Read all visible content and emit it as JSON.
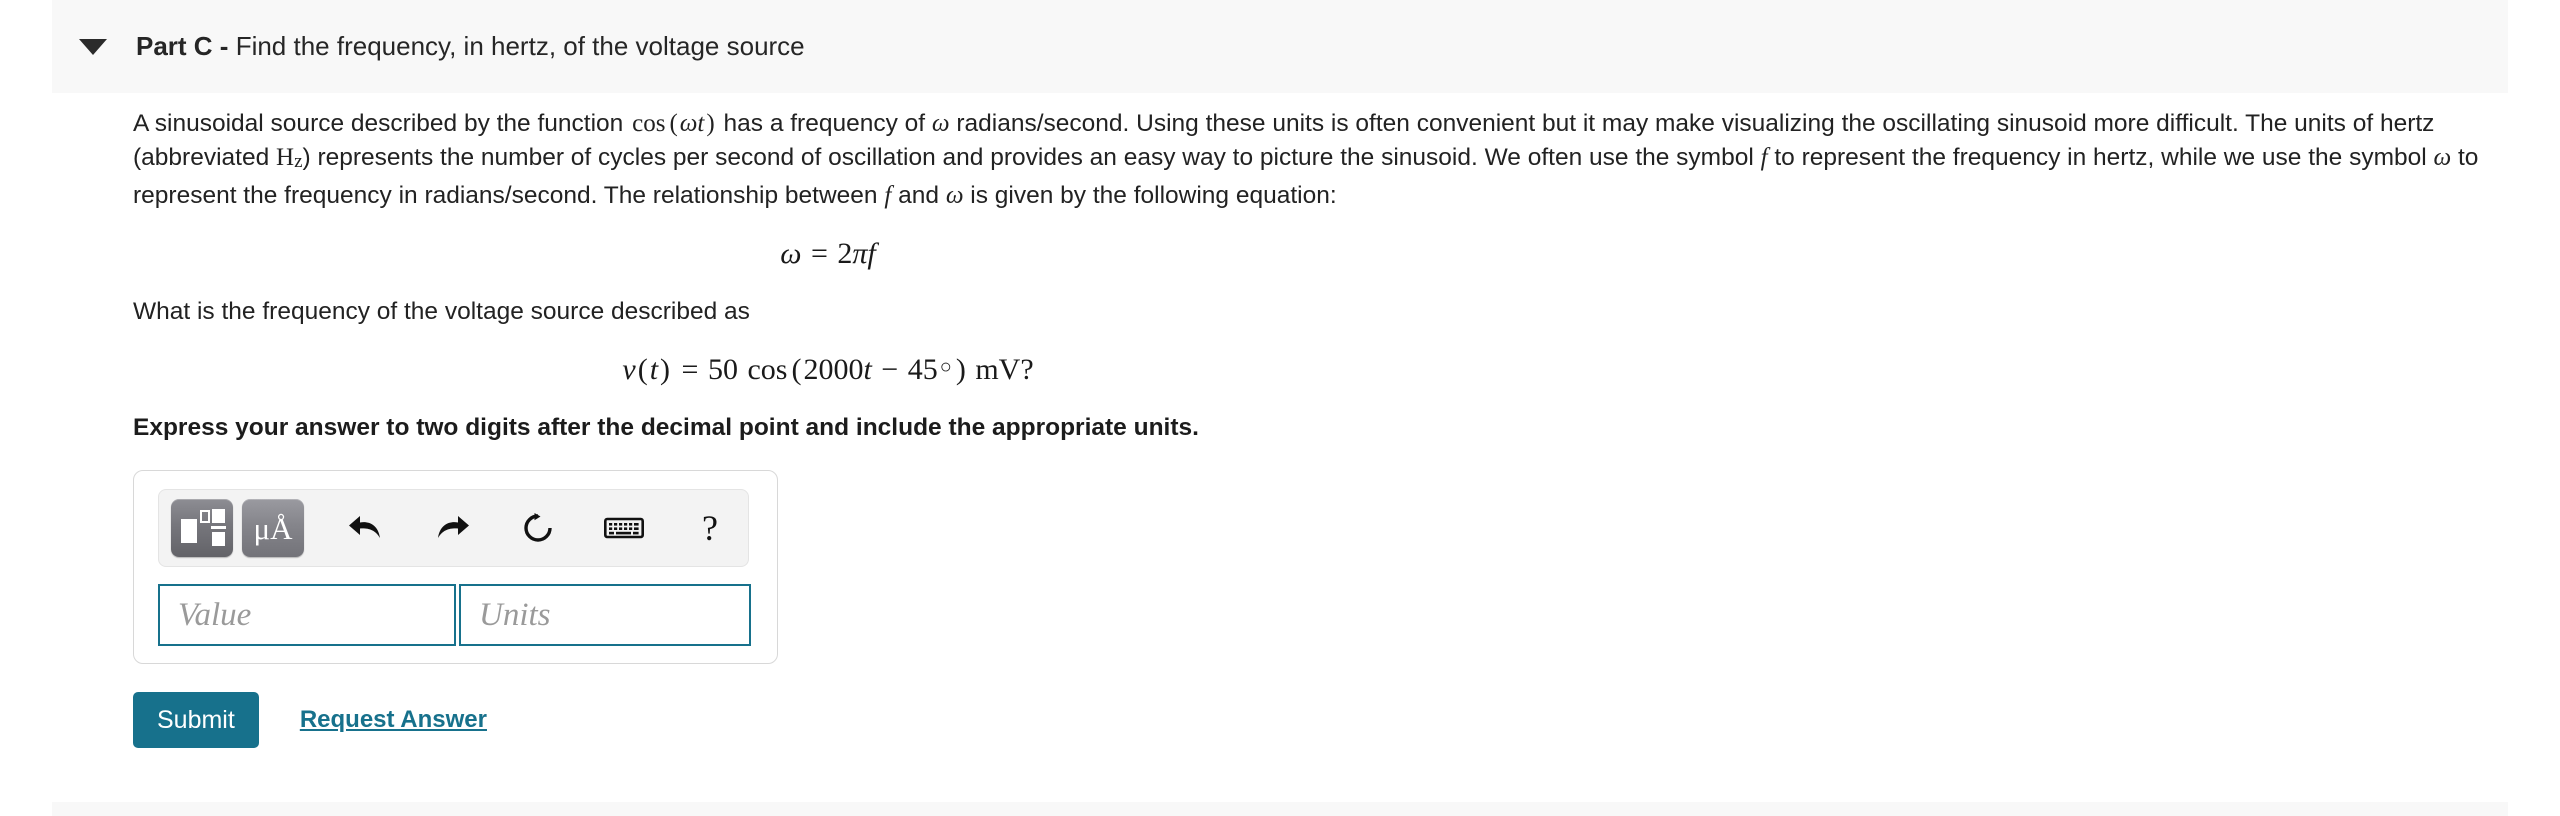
{
  "header": {
    "disclosure_icon": "chevron-down-icon",
    "part_label": "Part C",
    "separator": " - ",
    "description": "Find the frequency, in hertz, of the voltage source"
  },
  "body": {
    "intro_segments": {
      "s1": "A sinusoidal source described by the function ",
      "m1": "cos(ωt)",
      "s2": " has a frequency of ",
      "m2": "ω",
      "s3": " radians/second. Using these units is often convenient but it may make visualizing the oscillating sinusoid more difficult. The units of hertz (abbreviated ",
      "m3": "Hz",
      "s4": ") represents the number of cycles per second of oscillation and provides an easy way to picture the sinusoid. We often use the symbol ",
      "m4": "f",
      "s5": " to represent the frequency in hertz, while we use the symbol ",
      "m5": "ω",
      "s6": " to represent the frequency in radians/second. The relationship between ",
      "m6": "f",
      "s7": " and ",
      "m7": "ω",
      "s8": " is given by the following equation:"
    },
    "equation_1": "ω = 2πf",
    "question": "What is the frequency of the voltage source described as",
    "equation_2": "v(t) = 50 cos(2000t − 45°) mV?",
    "instruction": "Express your answer to two digits after the decimal point and include the appropriate units."
  },
  "answer_toolbar": {
    "template_button": "math-template-icon",
    "units_button": "μÅ",
    "undo_button": "undo-icon",
    "redo_button": "redo-icon",
    "reset_button": "reset-icon",
    "keyboard_button": "keyboard-icon",
    "help_button": "?"
  },
  "answer_fields": {
    "value_placeholder": "Value",
    "units_placeholder": "Units",
    "value": "",
    "units": ""
  },
  "actions": {
    "submit_label": "Submit",
    "request_answer_label": "Request Answer"
  },
  "colors": {
    "accent_teal": "#17718c",
    "header_bg": "#f8f8f8",
    "field_border": "#17718c"
  }
}
